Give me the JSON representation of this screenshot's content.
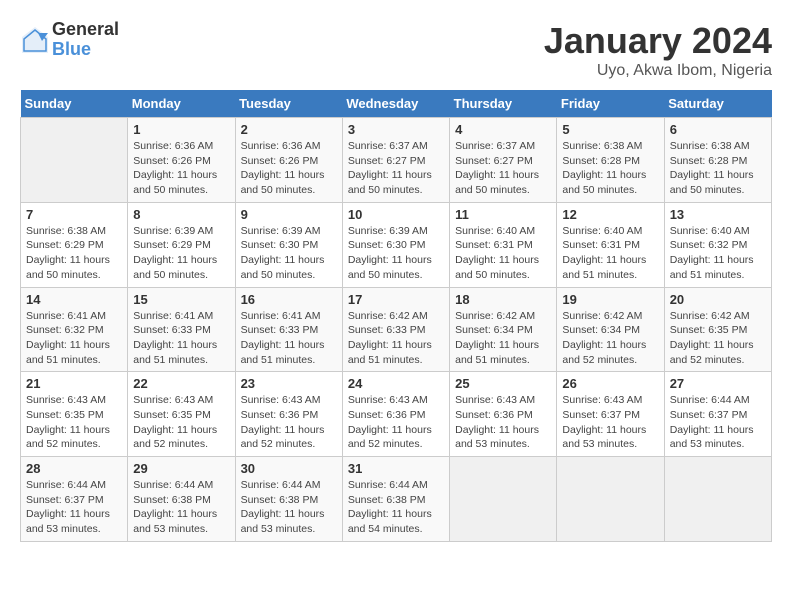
{
  "logo": {
    "general": "General",
    "blue": "Blue"
  },
  "title": "January 2024",
  "subtitle": "Uyo, Akwa Ibom, Nigeria",
  "days_of_week": [
    "Sunday",
    "Monday",
    "Tuesday",
    "Wednesday",
    "Thursday",
    "Friday",
    "Saturday"
  ],
  "weeks": [
    [
      {
        "day": "",
        "info": ""
      },
      {
        "day": "1",
        "info": "Sunrise: 6:36 AM\nSunset: 6:26 PM\nDaylight: 11 hours\nand 50 minutes."
      },
      {
        "day": "2",
        "info": "Sunrise: 6:36 AM\nSunset: 6:26 PM\nDaylight: 11 hours\nand 50 minutes."
      },
      {
        "day": "3",
        "info": "Sunrise: 6:37 AM\nSunset: 6:27 PM\nDaylight: 11 hours\nand 50 minutes."
      },
      {
        "day": "4",
        "info": "Sunrise: 6:37 AM\nSunset: 6:27 PM\nDaylight: 11 hours\nand 50 minutes."
      },
      {
        "day": "5",
        "info": "Sunrise: 6:38 AM\nSunset: 6:28 PM\nDaylight: 11 hours\nand 50 minutes."
      },
      {
        "day": "6",
        "info": "Sunrise: 6:38 AM\nSunset: 6:28 PM\nDaylight: 11 hours\nand 50 minutes."
      }
    ],
    [
      {
        "day": "7",
        "info": "Sunrise: 6:38 AM\nSunset: 6:29 PM\nDaylight: 11 hours\nand 50 minutes."
      },
      {
        "day": "8",
        "info": "Sunrise: 6:39 AM\nSunset: 6:29 PM\nDaylight: 11 hours\nand 50 minutes."
      },
      {
        "day": "9",
        "info": "Sunrise: 6:39 AM\nSunset: 6:30 PM\nDaylight: 11 hours\nand 50 minutes."
      },
      {
        "day": "10",
        "info": "Sunrise: 6:39 AM\nSunset: 6:30 PM\nDaylight: 11 hours\nand 50 minutes."
      },
      {
        "day": "11",
        "info": "Sunrise: 6:40 AM\nSunset: 6:31 PM\nDaylight: 11 hours\nand 50 minutes."
      },
      {
        "day": "12",
        "info": "Sunrise: 6:40 AM\nSunset: 6:31 PM\nDaylight: 11 hours\nand 51 minutes."
      },
      {
        "day": "13",
        "info": "Sunrise: 6:40 AM\nSunset: 6:32 PM\nDaylight: 11 hours\nand 51 minutes."
      }
    ],
    [
      {
        "day": "14",
        "info": "Sunrise: 6:41 AM\nSunset: 6:32 PM\nDaylight: 11 hours\nand 51 minutes."
      },
      {
        "day": "15",
        "info": "Sunrise: 6:41 AM\nSunset: 6:33 PM\nDaylight: 11 hours\nand 51 minutes."
      },
      {
        "day": "16",
        "info": "Sunrise: 6:41 AM\nSunset: 6:33 PM\nDaylight: 11 hours\nand 51 minutes."
      },
      {
        "day": "17",
        "info": "Sunrise: 6:42 AM\nSunset: 6:33 PM\nDaylight: 11 hours\nand 51 minutes."
      },
      {
        "day": "18",
        "info": "Sunrise: 6:42 AM\nSunset: 6:34 PM\nDaylight: 11 hours\nand 51 minutes."
      },
      {
        "day": "19",
        "info": "Sunrise: 6:42 AM\nSunset: 6:34 PM\nDaylight: 11 hours\nand 52 minutes."
      },
      {
        "day": "20",
        "info": "Sunrise: 6:42 AM\nSunset: 6:35 PM\nDaylight: 11 hours\nand 52 minutes."
      }
    ],
    [
      {
        "day": "21",
        "info": "Sunrise: 6:43 AM\nSunset: 6:35 PM\nDaylight: 11 hours\nand 52 minutes."
      },
      {
        "day": "22",
        "info": "Sunrise: 6:43 AM\nSunset: 6:35 PM\nDaylight: 11 hours\nand 52 minutes."
      },
      {
        "day": "23",
        "info": "Sunrise: 6:43 AM\nSunset: 6:36 PM\nDaylight: 11 hours\nand 52 minutes."
      },
      {
        "day": "24",
        "info": "Sunrise: 6:43 AM\nSunset: 6:36 PM\nDaylight: 11 hours\nand 52 minutes."
      },
      {
        "day": "25",
        "info": "Sunrise: 6:43 AM\nSunset: 6:36 PM\nDaylight: 11 hours\nand 53 minutes."
      },
      {
        "day": "26",
        "info": "Sunrise: 6:43 AM\nSunset: 6:37 PM\nDaylight: 11 hours\nand 53 minutes."
      },
      {
        "day": "27",
        "info": "Sunrise: 6:44 AM\nSunset: 6:37 PM\nDaylight: 11 hours\nand 53 minutes."
      }
    ],
    [
      {
        "day": "28",
        "info": "Sunrise: 6:44 AM\nSunset: 6:37 PM\nDaylight: 11 hours\nand 53 minutes."
      },
      {
        "day": "29",
        "info": "Sunrise: 6:44 AM\nSunset: 6:38 PM\nDaylight: 11 hours\nand 53 minutes."
      },
      {
        "day": "30",
        "info": "Sunrise: 6:44 AM\nSunset: 6:38 PM\nDaylight: 11 hours\nand 53 minutes."
      },
      {
        "day": "31",
        "info": "Sunrise: 6:44 AM\nSunset: 6:38 PM\nDaylight: 11 hours\nand 54 minutes."
      },
      {
        "day": "",
        "info": ""
      },
      {
        "day": "",
        "info": ""
      },
      {
        "day": "",
        "info": ""
      }
    ]
  ]
}
